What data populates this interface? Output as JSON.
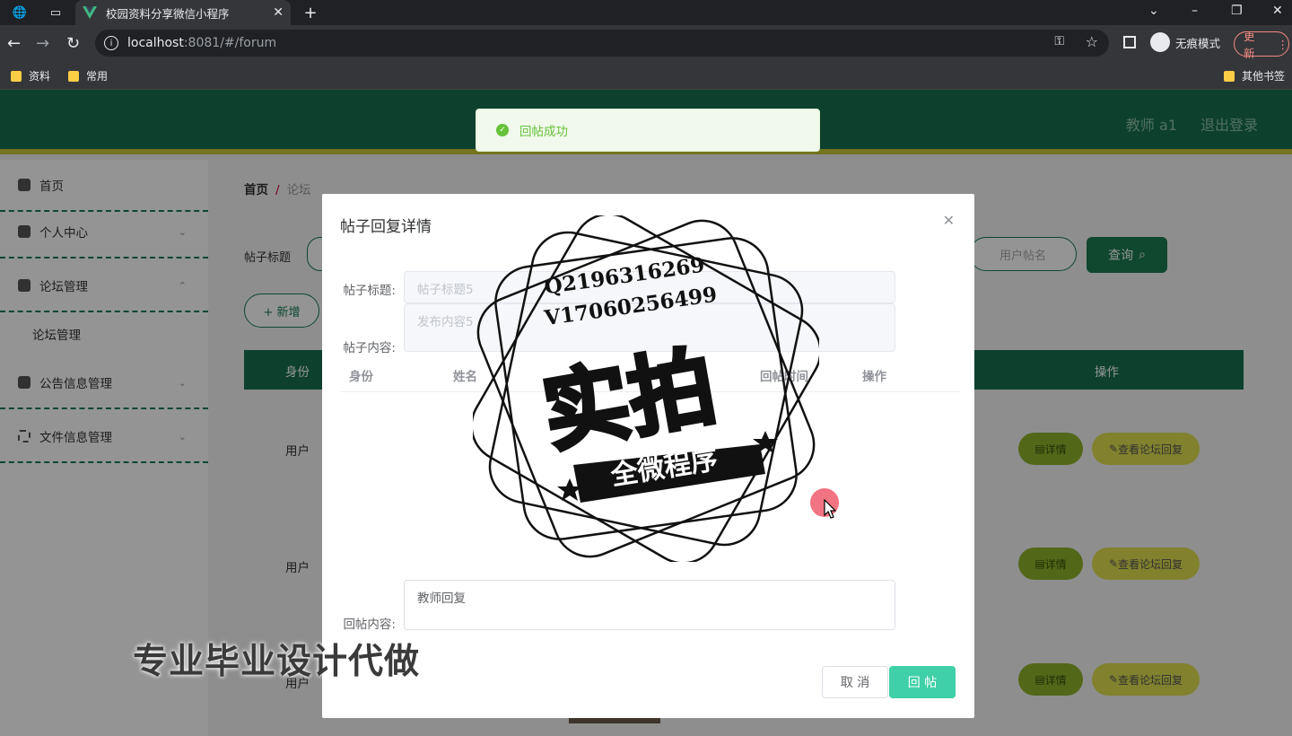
{
  "browser": {
    "tab_title": "校园资料分享微信小程序",
    "url_host": "localhost",
    "url_path": ":8081/#/forum",
    "incognito_label": "无痕模式",
    "update_label": "更新",
    "bookmarks": [
      "资料",
      "常用"
    ],
    "other_bookmarks": "其他书签"
  },
  "header": {
    "user": "教师 a1",
    "logout": "退出登录"
  },
  "toast": {
    "message": "回帖成功"
  },
  "sidebar": {
    "items": [
      {
        "label": "首页"
      },
      {
        "label": "个人中心"
      },
      {
        "label": "论坛管理"
      },
      {
        "label": "公告信息管理"
      },
      {
        "label": "文件信息管理"
      }
    ],
    "sub_item": "论坛管理"
  },
  "main": {
    "breadcrumb_home": "首页",
    "breadcrumb_current": "论坛",
    "search_label": "帖子标题",
    "search_placeholder_2": "用户帖名",
    "query_button": "查询",
    "add_button": "+ 新增",
    "columns": {
      "identity": "身份",
      "action": "操作"
    },
    "rows": [
      {
        "identity": "用户",
        "detail": "详情",
        "reply": "查看论坛回复"
      },
      {
        "identity": "用户",
        "detail": "详情",
        "reply": "查看论坛回复"
      },
      {
        "identity": "用户",
        "detail": "详情",
        "reply": "查看论坛回复"
      }
    ]
  },
  "dialog": {
    "title": "帖子回复详情",
    "title_label": "帖子标题:",
    "title_value": "帖子标题5",
    "content_label": "帖子内容:",
    "content_value": "发布内容5",
    "sub_columns": [
      "身份",
      "姓名",
      "回帖时间",
      "操作"
    ],
    "reply_label": "回帖内容:",
    "reply_value": "教师回复",
    "cancel": "取 消",
    "submit": "回 帖"
  },
  "watermark": {
    "q_line": "Q2196316269",
    "v_line": "V17060256499",
    "big": "实拍",
    "banner": "全微程序",
    "caption": "专业毕业设计代做"
  }
}
